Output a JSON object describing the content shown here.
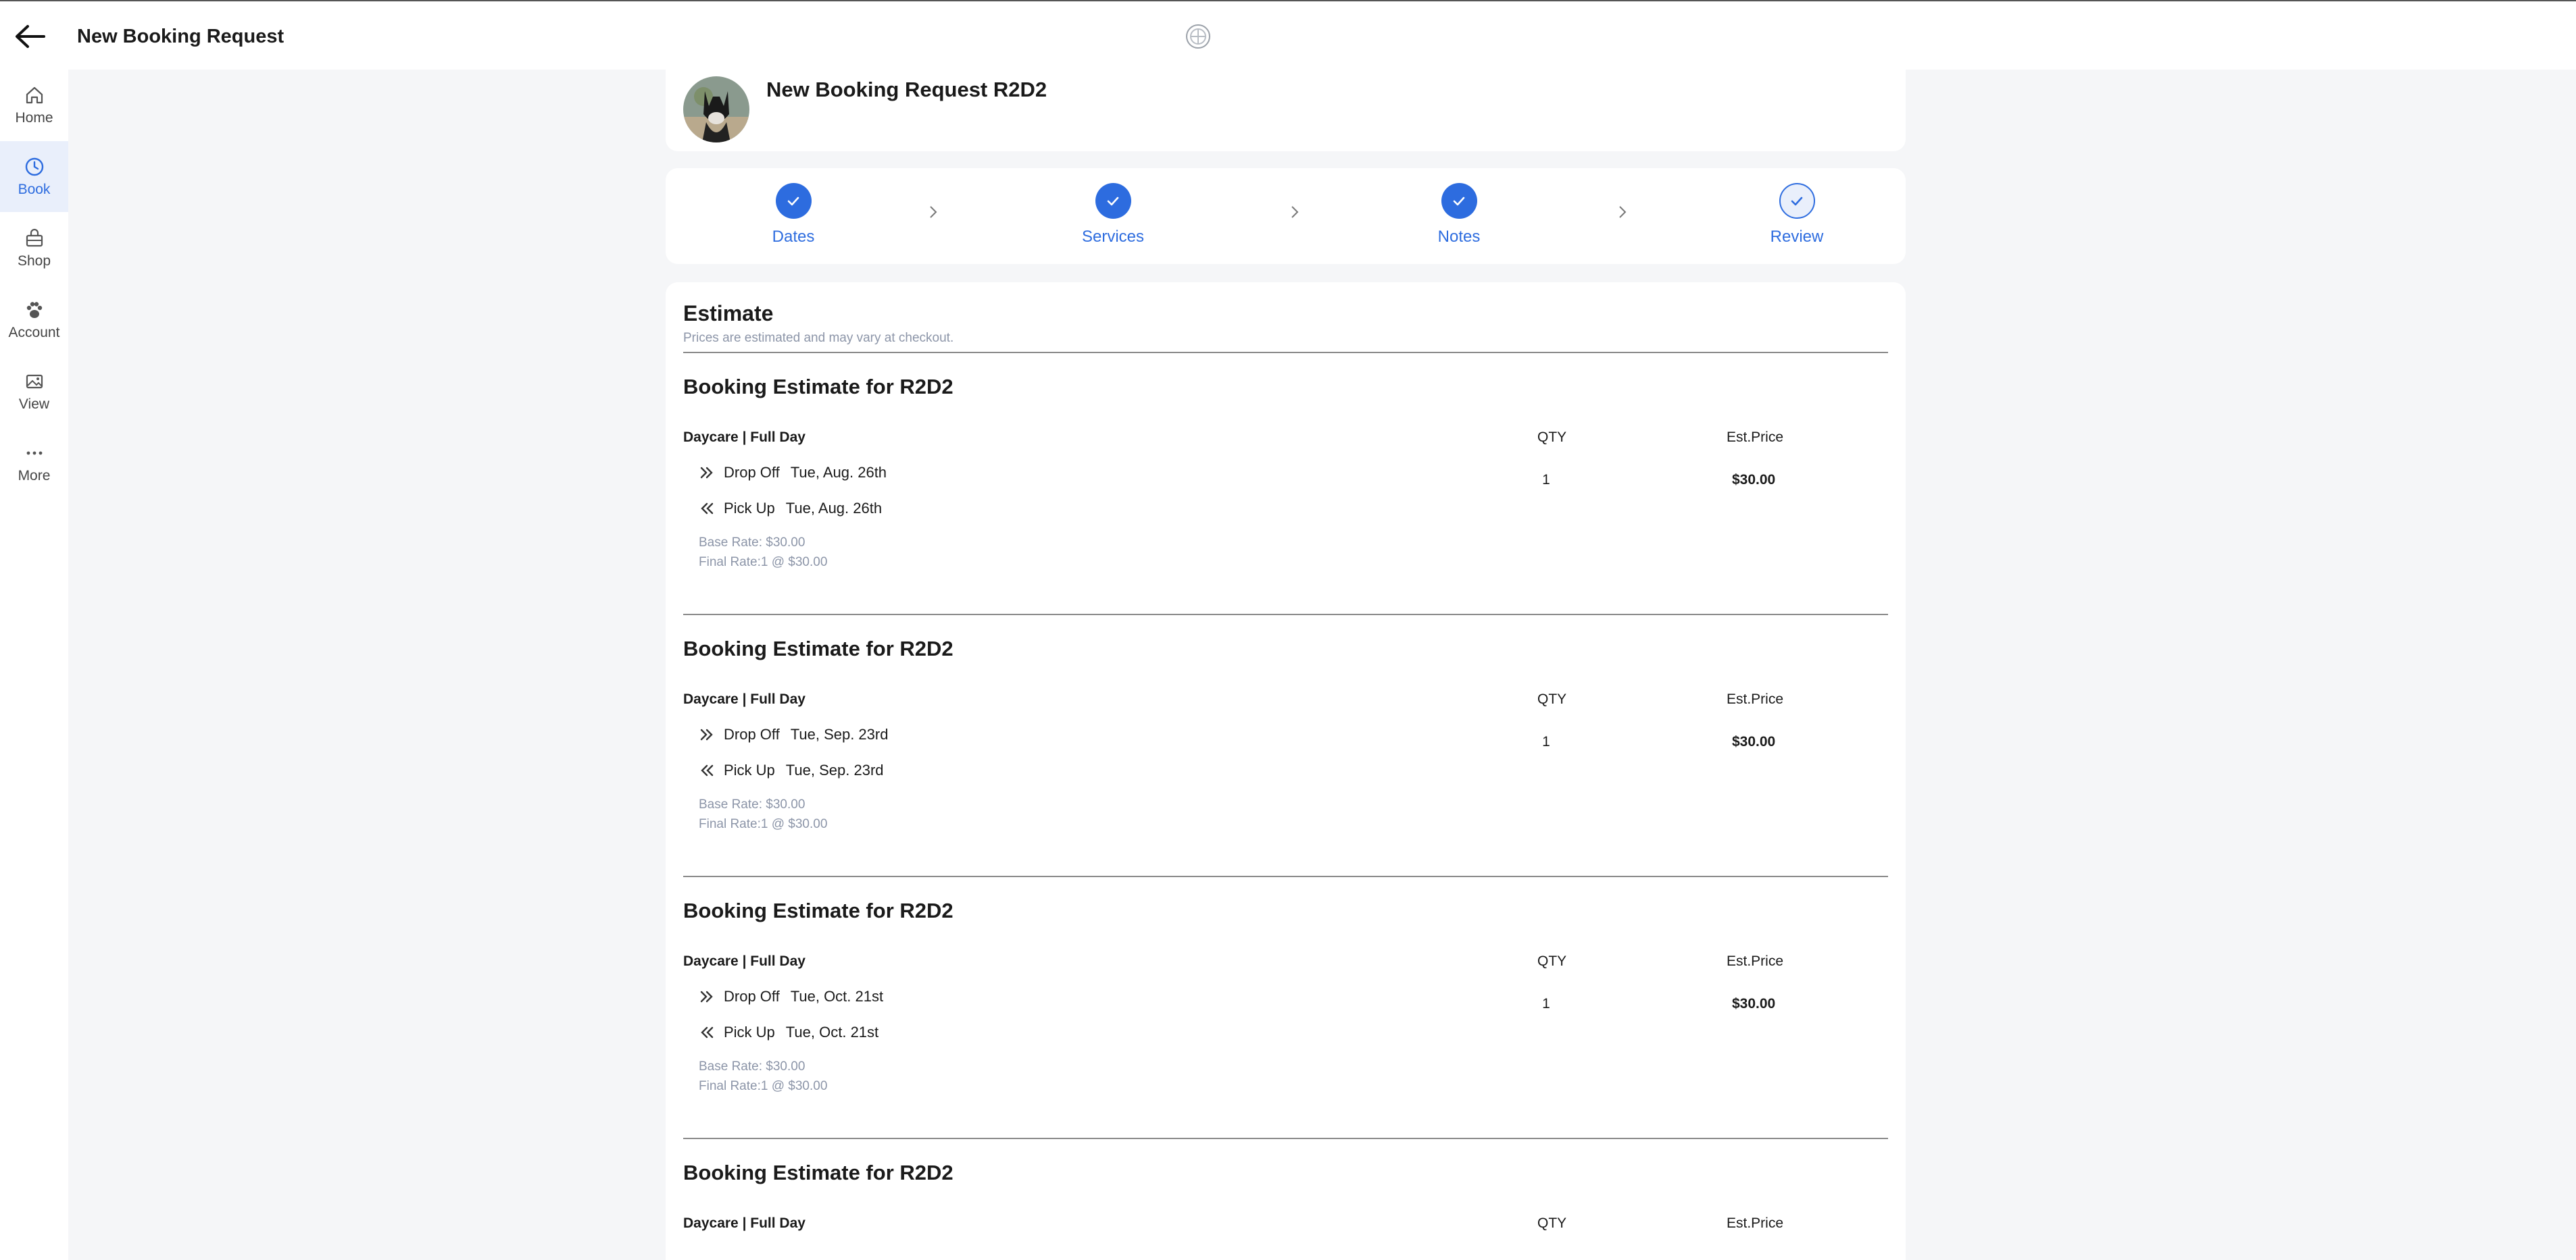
{
  "header": {
    "title": "New Booking Request"
  },
  "sidebar": {
    "items": [
      {
        "label": "Home",
        "icon": "home-icon"
      },
      {
        "label": "Book",
        "icon": "clock-icon",
        "active": true
      },
      {
        "label": "Shop",
        "icon": "shop-icon"
      },
      {
        "label": "Account",
        "icon": "paw-icon"
      },
      {
        "label": "View",
        "icon": "image-icon"
      },
      {
        "label": "More",
        "icon": "more-icon"
      }
    ]
  },
  "pet_card": {
    "title": "New Booking Request R2D2"
  },
  "steps": [
    {
      "label": "Dates"
    },
    {
      "label": "Services"
    },
    {
      "label": "Notes"
    },
    {
      "label": "Review"
    }
  ],
  "estimate": {
    "title": "Estimate",
    "subtitle": "Prices are estimated and may vary at checkout.",
    "blocks": [
      {
        "title": "Booking Estimate for R2D2",
        "service": "Daycare | Full Day",
        "qty_header": "QTY",
        "price_header": "Est.Price",
        "dropoff_label": "Drop Off",
        "dropoff_date": "Tue, Aug. 26th",
        "pickup_label": "Pick Up",
        "pickup_date": "Tue, Aug. 26th",
        "qty": "1",
        "price": "$30.00",
        "base_rate": "Base Rate: $30.00",
        "final_rate": "Final Rate:1 @ $30.00"
      },
      {
        "title": "Booking Estimate for R2D2",
        "service": "Daycare | Full Day",
        "qty_header": "QTY",
        "price_header": "Est.Price",
        "dropoff_label": "Drop Off",
        "dropoff_date": "Tue, Sep. 23rd",
        "pickup_label": "Pick Up",
        "pickup_date": "Tue, Sep. 23rd",
        "qty": "1",
        "price": "$30.00",
        "base_rate": "Base Rate: $30.00",
        "final_rate": "Final Rate:1 @ $30.00"
      },
      {
        "title": "Booking Estimate for R2D2",
        "service": "Daycare | Full Day",
        "qty_header": "QTY",
        "price_header": "Est.Price",
        "dropoff_label": "Drop Off",
        "dropoff_date": "Tue, Oct. 21st",
        "pickup_label": "Pick Up",
        "pickup_date": "Tue, Oct. 21st",
        "qty": "1",
        "price": "$30.00",
        "base_rate": "Base Rate: $30.00",
        "final_rate": "Final Rate:1 @ $30.00"
      },
      {
        "title": "Booking Estimate for R2D2",
        "service": "Daycare | Full Day",
        "qty_header": "QTY",
        "price_header": "Est.Price"
      }
    ]
  },
  "colors": {
    "accent": "#2d6cdf",
    "muted": "#8c95a8",
    "background": "#f5f6f8"
  }
}
